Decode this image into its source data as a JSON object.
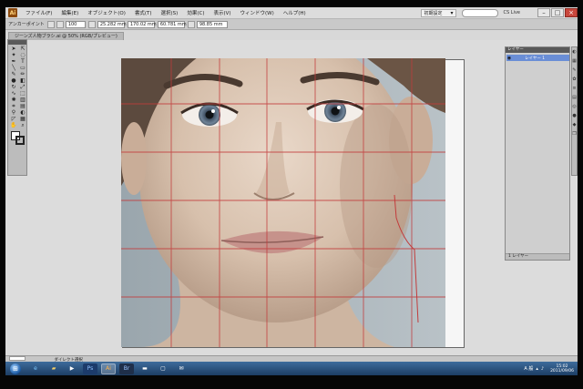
{
  "menubar": {
    "app_icon": "Ai",
    "items": [
      "ファイル(F)",
      "編集(E)",
      "オブジェクト(O)",
      "書式(T)",
      "選択(S)",
      "効果(C)",
      "表示(V)",
      "ウィンドウ(W)",
      "ヘルプ(H)"
    ],
    "workspace": "初期設定",
    "cs_live": "CS Live"
  },
  "controlbar": {
    "label": "アンカーポイント",
    "fields": [
      "100",
      "25.282 mm",
      "170.02 mm",
      "60.781 mm",
      "98.85 mm"
    ]
  },
  "document_tab": "ジーンズ人物ブラシ.ai @ 50% (RGB/プレビュー)",
  "layers_panel": {
    "tab": "レイヤー",
    "layer_name": "レイヤー 1",
    "footer": "1 レイヤー"
  },
  "statusbar": {
    "tool_label": "ダイレクト選択"
  },
  "taskbar": {
    "time": "15:02",
    "date": "2011/09/06",
    "lang": "A 般",
    "colors": {
      "bar_top": "#3d6c9c",
      "bar_bottom": "#1d3d64"
    }
  },
  "icons": [
    "ai-app-icon",
    "search-icon",
    "minimize-icon",
    "maximize-icon",
    "close-icon",
    "selection-tool-icon",
    "direct-selection-icon",
    "pen-tool-icon",
    "type-tool-icon",
    "eye-icon",
    "windows-start-icon"
  ]
}
